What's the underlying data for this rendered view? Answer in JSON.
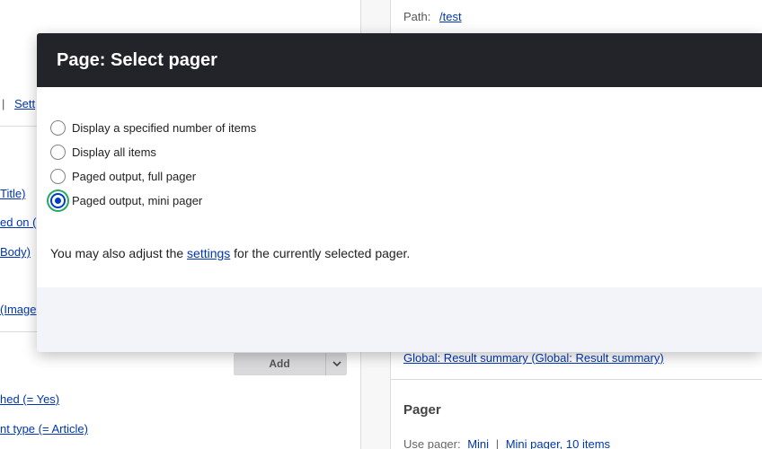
{
  "background": {
    "path_label": "Path:",
    "path_value": "/test",
    "settings_fragment": "Sett",
    "separator": "|",
    "left_links": [
      "Title)",
      "ed on (",
      "Body)",
      "(Image",
      "hed (= Yes)",
      "nt type (= Article)"
    ],
    "add_button_label": "Add",
    "result_summary_link": "Global: Result summary (Global: Result summary)",
    "pager_heading": "Pager",
    "use_pager_label": "Use pager:",
    "use_pager_value": "Mini",
    "use_pager_sep": "|",
    "use_pager_items": "Mini pager, 10 items"
  },
  "modal": {
    "title": "Page: Select pager",
    "options": [
      {
        "label": "Display a specified number of items",
        "checked": false
      },
      {
        "label": "Display all items",
        "checked": false
      },
      {
        "label": "Paged output, full pager",
        "checked": false
      },
      {
        "label": "Paged output, mini pager",
        "checked": true
      }
    ],
    "help_prefix": "You may also adjust the",
    "help_link": "settings",
    "help_suffix": "for the currently selected pager."
  }
}
